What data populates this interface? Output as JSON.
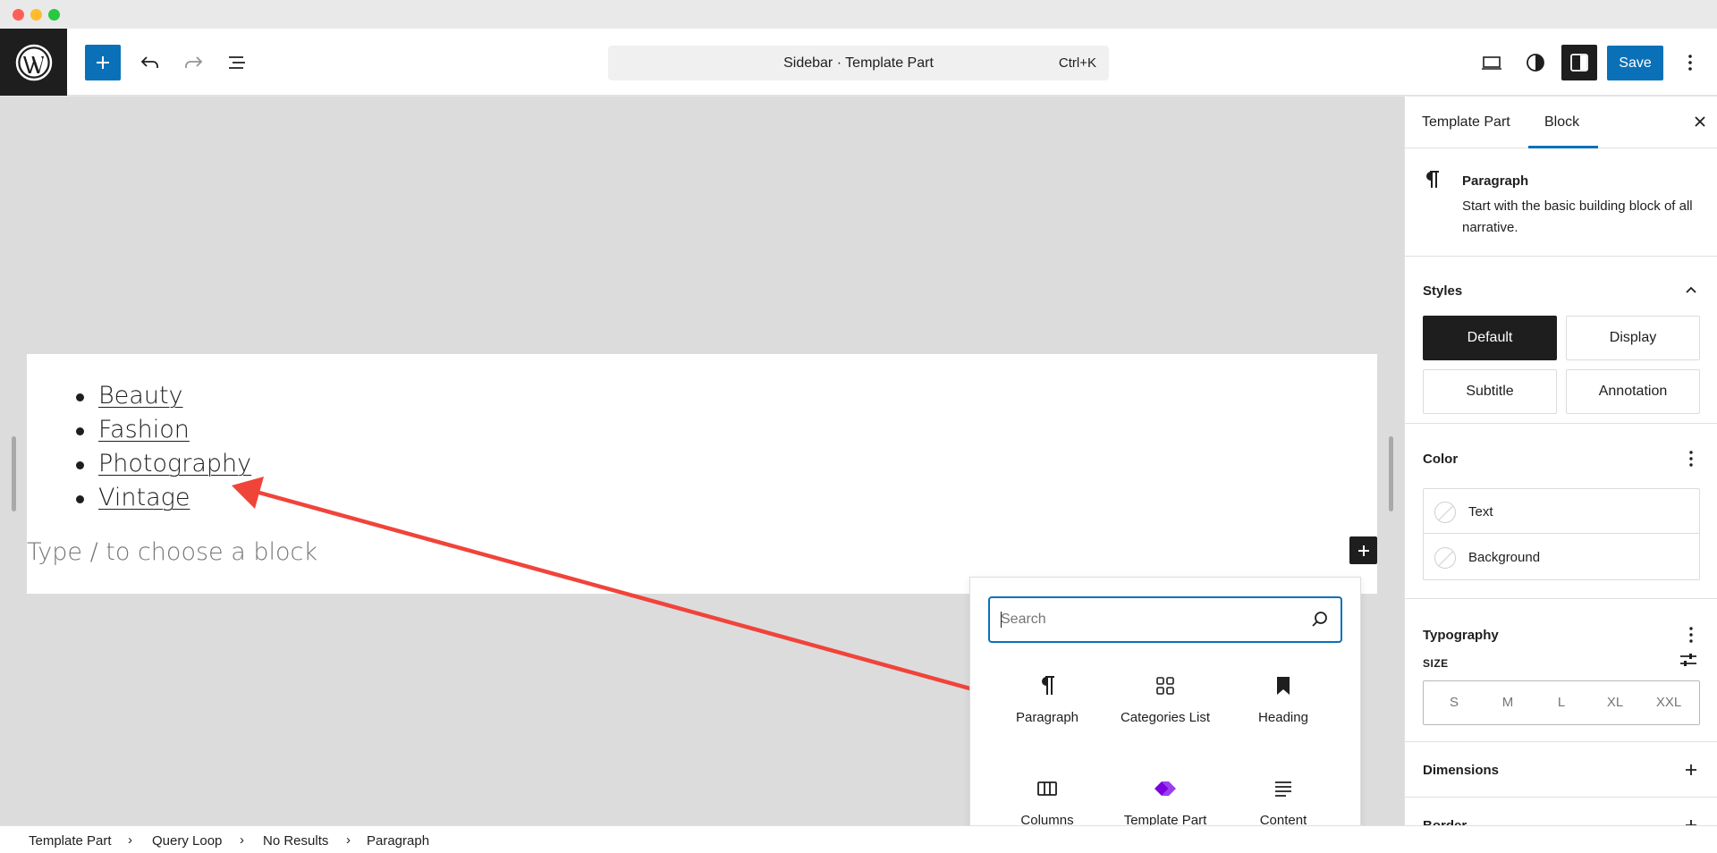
{
  "toolbar": {
    "document_title": "Sidebar · Template Part",
    "shortcut": "Ctrl+K",
    "save_label": "Save"
  },
  "canvas": {
    "categories": [
      "Beauty",
      "Fashion",
      "Photography",
      "Vintage"
    ],
    "placeholder": "Type / to choose a block",
    "annotation_arrow_color": "#f0443a"
  },
  "inserter": {
    "search_placeholder": "Search",
    "blocks": [
      {
        "label": "Paragraph",
        "icon": "paragraph-icon"
      },
      {
        "label": "Categories List",
        "icon": "categories-grid-icon"
      },
      {
        "label": "Heading",
        "icon": "bookmark-icon"
      },
      {
        "label": "Columns",
        "icon": "columns-icon"
      },
      {
        "label": "Template Part",
        "icon": "template-part-icon"
      },
      {
        "label": "Content",
        "icon": "content-lines-icon"
      }
    ]
  },
  "breadcrumb": [
    "Template Part",
    "Query Loop",
    "No Results",
    "Paragraph"
  ],
  "sidebar": {
    "tabs": [
      "Template Part",
      "Block"
    ],
    "active_tab": "Block",
    "block_card": {
      "title": "Paragraph",
      "description": "Start with the basic building block of all narrative."
    },
    "styles": {
      "title": "Styles",
      "options": [
        "Default",
        "Display",
        "Subtitle",
        "Annotation"
      ],
      "selected": "Default"
    },
    "color": {
      "title": "Color",
      "items": [
        "Text",
        "Background"
      ]
    },
    "typography": {
      "title": "Typography",
      "size_label": "SIZE",
      "sizes": [
        "S",
        "M",
        "L",
        "XL",
        "XXL"
      ]
    },
    "dimensions": {
      "title": "Dimensions"
    },
    "border": {
      "title": "Border"
    }
  },
  "colors": {
    "accent": "#0a71b8",
    "dark": "#1e1e1e",
    "canvas_bg": "#dcdcdc",
    "template_part_icon": "#7a00df"
  }
}
